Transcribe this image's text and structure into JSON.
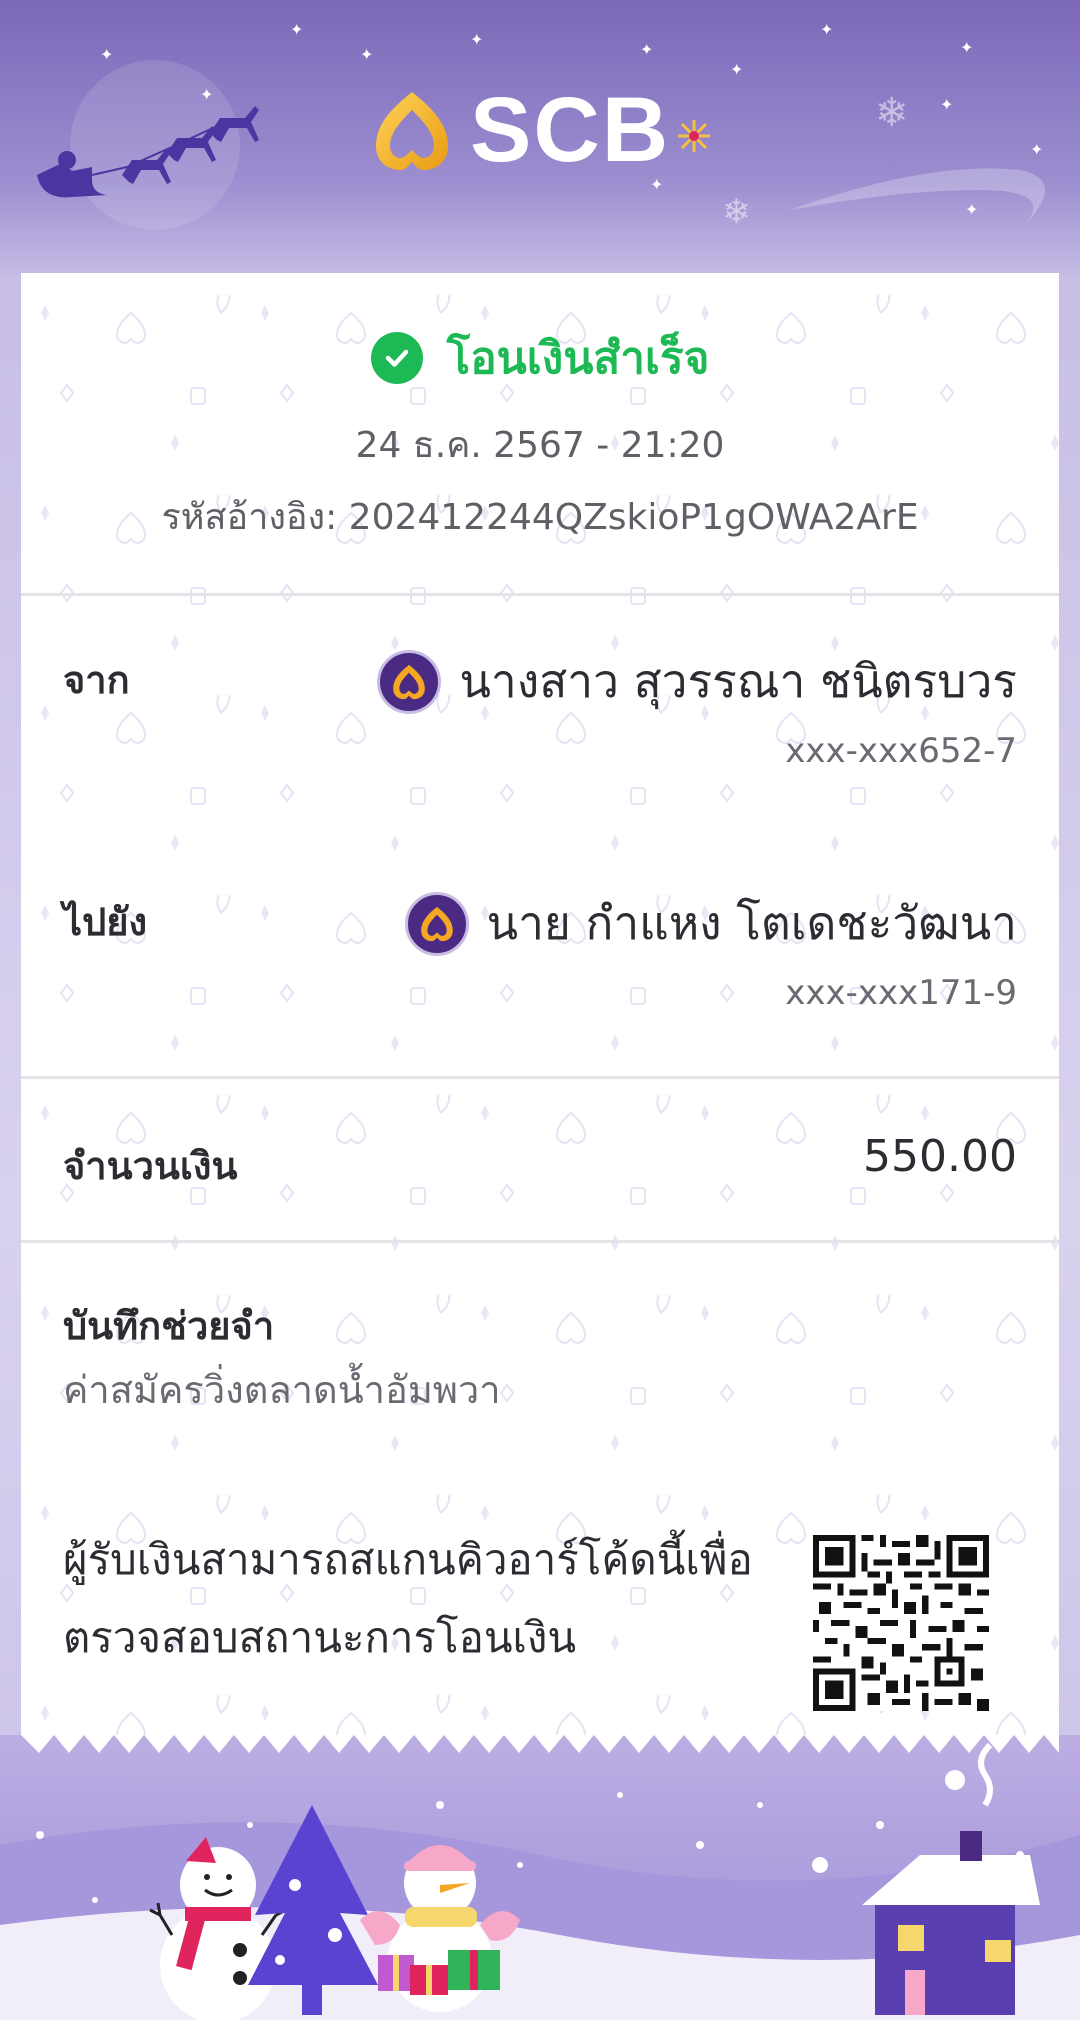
{
  "brand": {
    "name": "SCB",
    "accent": "#f5a623",
    "purple": "#4b2a84",
    "success": "#1db954"
  },
  "status": {
    "icon": "check-circle-icon",
    "text": "โอนเงินสำเร็จ"
  },
  "datetime": "24 ธ.ค. 2567 - 21:20",
  "reference": "รหัสอ้างอิง: 202412244QZskioP1gOWA2ArE",
  "from": {
    "label": "จาก",
    "name": "นางสาว สุวรรณา ชนิตรบวร",
    "account": "xxx-xxx652-7",
    "icon": "scb-bank-icon"
  },
  "to": {
    "label": "ไปยัง",
    "name": "นาย กำแหง โตเดชะวัฒนา",
    "account": "xxx-xxx171-9",
    "icon": "scb-bank-icon"
  },
  "amount": {
    "label": "จำนวนเงิน",
    "value": "550.00"
  },
  "memo": {
    "label": "บันทึกช่วยจำ",
    "value": "ค่าสมัครวิ่งตลาดน้ำอัมพวา"
  },
  "qr": {
    "line1": "ผู้รับเงินสามารถสแกนคิวอาร์โค้ดนี้เพื่อ",
    "line2": "ตรวจสอบสถานะการโอนเงิน",
    "icon": "qr-code-icon"
  }
}
